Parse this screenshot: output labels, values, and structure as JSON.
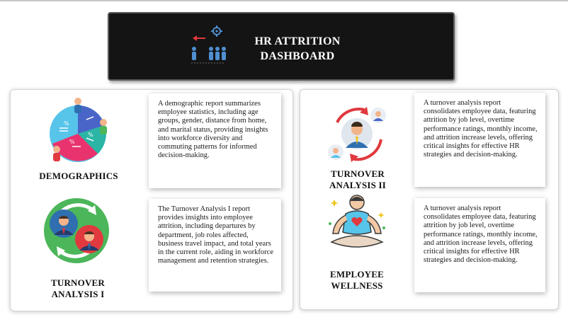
{
  "header": {
    "title_line1": "HR ATTRITION",
    "title_line2": "DASHBOARD"
  },
  "sections": {
    "demographics": {
      "label": "DEMOGRAPHICS",
      "description": "A demographic report summarizes employee statistics, including age groups, gender, distance from home, and marital status, providing insights into workforce diversity and commuting patterns for informed decision-making.",
      "icon": "pie-people-icon"
    },
    "turnover1": {
      "label_line1": "TURNOVER",
      "label_line2": "ANALYSIS I",
      "description": "The Turnover Analysis I report provides insights into employee attrition, including departures by department, job roles affected, business travel impact, and total years in the current role, aiding in workforce management and retention strategies.",
      "icon": "swap-people-icon"
    },
    "turnover2": {
      "label_line1": "TURNOVER",
      "label_line2": "ANALYSIS II",
      "description": "A turnover analysis report consolidates employee data, featuring attrition by job level, overtime performance ratings, monthly income, and attrition increase levels, offering critical insights for effective HR strategies and decision-making.",
      "icon": "cycle-people-icon"
    },
    "wellness": {
      "label_line1": "EMPLOYEE",
      "label_line2": "WELLNESS",
      "description": "A turnover analysis report consolidates employee data, featuring attrition by job level, overtime performance ratings, monthly income, and attrition increase levels, offering critical insights for effective HR strategies and decision-making.",
      "icon": "meditation-icon"
    }
  },
  "colors": {
    "header_bg": "#141414",
    "blue": "#2f6fb0",
    "red": "#e0393e",
    "green": "#4cb65a",
    "pink": "#e8336e",
    "teal": "#2bb5a4"
  }
}
